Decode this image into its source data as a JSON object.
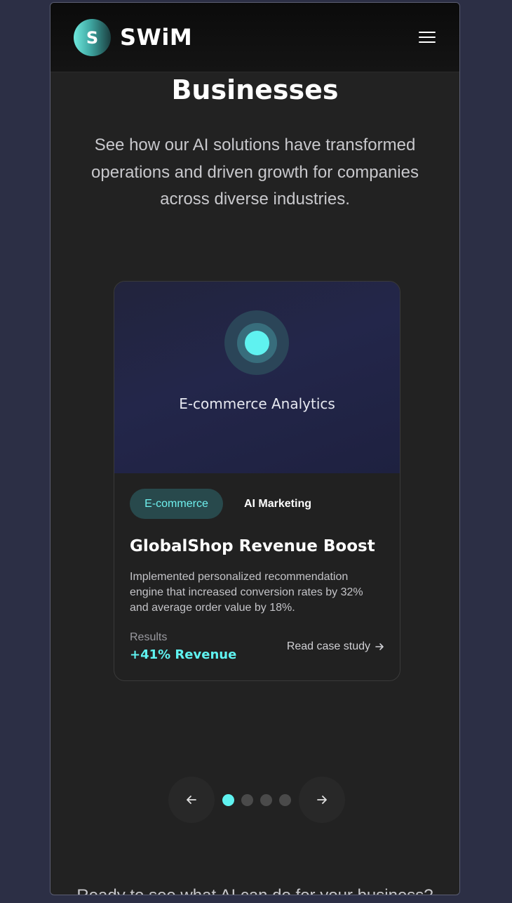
{
  "header": {
    "logo_letter": "S",
    "brand": "SWiM",
    "menu_icon": "hamburger-menu-icon"
  },
  "section": {
    "heading": "Businesses",
    "intro": "See how our AI solutions have transformed operations and driven growth for companies across diverse industries."
  },
  "card": {
    "hero_title": "E-commerce Analytics",
    "tags": [
      "E-commerce",
      "AI Marketing"
    ],
    "title": "GlobalShop Revenue Boost",
    "description": "Implemented personalized recommendation engine that increased conversion rates by 32% and average order value by 18%.",
    "results_label": "Results",
    "results_value": "+41% Revenue",
    "link_label": "Read case study",
    "link_icon": "arrow-right-icon"
  },
  "carousel": {
    "prev_icon": "arrow-left-icon",
    "next_icon": "arrow-right-icon",
    "dot_count": 4,
    "active_index": 0
  },
  "cta": {
    "text": "Ready to see what AI can do for your business?"
  },
  "colors": {
    "accent": "#5ff2f0",
    "background": "#222222",
    "page_bg": "#2c2f45"
  }
}
